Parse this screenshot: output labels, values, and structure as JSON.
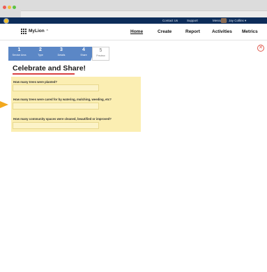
{
  "topbar": {
    "contact_label": "Contact Us",
    "support_label": "Support",
    "messages_label": "Messages",
    "user_label": "Jay Collins ▾"
  },
  "navbar": {
    "brand_label": "MyLion",
    "brand_caret": "⌃",
    "links": [
      "Home",
      "Create",
      "Report",
      "Activities",
      "Metrics"
    ],
    "active_link": "Home"
  },
  "progress": {
    "steps": [
      {
        "num": "1",
        "label": "Service Area"
      },
      {
        "num": "2",
        "label": "Type"
      },
      {
        "num": "3",
        "label": "Details"
      },
      {
        "num": "4",
        "label": "Share"
      },
      {
        "num": "5",
        "label": "Preview"
      }
    ],
    "current_step": 4
  },
  "close_label": "✕",
  "main": {
    "heading": "Celebrate and Share!",
    "questions": [
      "How many trees were planted?",
      "How many trees were cared for by watering, mulching, weeding, etc?",
      "How many community spaces were cleaned, beautified or improved?"
    ]
  },
  "colors": {
    "topbar_bg": "#0d2d5a",
    "step_done": "#5b87c6",
    "heading_accent": "#d94141",
    "form_panel_bg": "#fbeeb2",
    "pointer": "#f2a81e",
    "close": "#e05a4f"
  }
}
